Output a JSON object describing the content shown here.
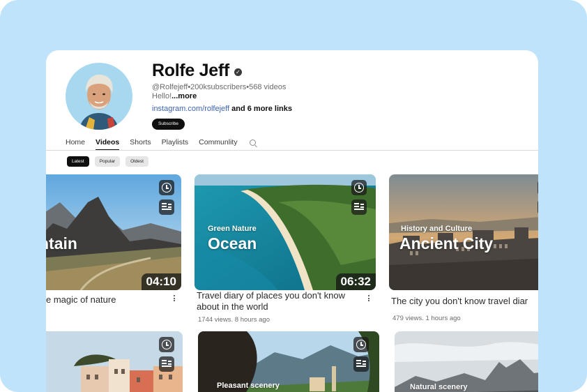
{
  "channel": {
    "name": "Rolfe Jeff",
    "meta": "@Rolfejeff•200ksubscribers•568 videos",
    "description": "Hello!",
    "description_more": "...more",
    "link": "instagram.com/rolfejeff",
    "link_more": "and 6 more links",
    "subscribe_label": "Subscribe"
  },
  "tabs": [
    "Home",
    "Videos",
    "Shorts",
    "Playlists",
    "Communlity"
  ],
  "active_tab": "Videos",
  "filters": [
    "Latest",
    "Popular",
    "Oldest"
  ],
  "active_filter": "Latest",
  "videos": [
    {
      "category": "",
      "big_title": "ntain",
      "duration": "04:10",
      "title": "e magic of nature",
      "stats": ""
    },
    {
      "category": "Green Nature",
      "big_title": "Ocean",
      "duration": "06:32",
      "title": "Travel diary of places you don't know about in the world",
      "stats": "1744 views. 8 hours ago"
    },
    {
      "category": "History and Culture",
      "big_title": "Ancient City",
      "duration": "",
      "title": "The city you don't know travel diar",
      "stats": "479 views. 1 hours ago"
    },
    {
      "category": "",
      "big_title": "",
      "duration": "",
      "title": "",
      "stats": ""
    },
    {
      "category": "Pleasant scenery",
      "big_title": "",
      "duration": "",
      "title": "",
      "stats": ""
    },
    {
      "category": "Natural scenery",
      "big_title": "",
      "duration": "",
      "title": "",
      "stats": ""
    }
  ],
  "icons": {
    "verified": "verified-check-icon",
    "search": "search-icon",
    "watch_later": "clock-icon",
    "add_queue": "add-to-queue-icon",
    "more": "more-vertical-icon"
  },
  "colors": {
    "background": "#bfe3fb",
    "card": "#ffffff",
    "link": "#3e63b4",
    "subscribe_bg": "#0f0f0f"
  }
}
